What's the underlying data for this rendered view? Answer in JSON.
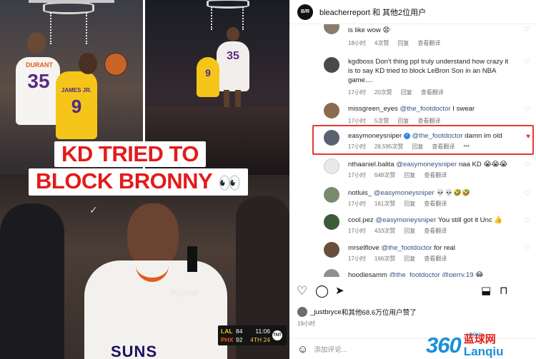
{
  "media": {
    "headline_line1": "KD TRIED TO",
    "headline_line2": "BLOCK BRONNY",
    "eyes_emoji": "👀",
    "jersey_left_name": "DURANT",
    "jersey_left_num": "35",
    "jersey_right_name": "JAMES JR.",
    "jersey_right_num": "9",
    "jersey_frame2_num": "35",
    "jersey_frame2_num2": "9",
    "sponsor": "PayPal",
    "bottom_team": "SUNS",
    "scorebug": {
      "team1": "LAL",
      "score1": "84",
      "team2": "PHX",
      "score2": "92",
      "clock": "11:06",
      "quarter": "4TH",
      "shot": "24",
      "network": "TNT"
    }
  },
  "header": {
    "account": "bleacherreport",
    "with_others": "和 其他2位用户"
  },
  "comments": [
    {
      "user": "",
      "text": "is like wow 😧",
      "time": "18小时",
      "likes": "4次赞",
      "reply": "回复",
      "translate": "查看翻译"
    },
    {
      "user": "kgdboss",
      "text": "Don't thing ppl truly understand how crazy it is to say KD tried to block LeBron Son in an NBA game....",
      "time": "17小时",
      "likes": "20次赞",
      "reply": "回复",
      "translate": "查看翻译"
    },
    {
      "user": "missgreen_eyes",
      "mention": "@the_footdoctor",
      "text": "I swear",
      "time": "17小时",
      "likes": "5次赞",
      "reply": "回复",
      "translate": "查看翻译"
    },
    {
      "user": "easymoneysniper",
      "mention": "@the_footdoctor",
      "text": "damn im old",
      "time": "17小时",
      "likes": "28,595次赞",
      "reply": "回复",
      "translate": "查看翻译",
      "more": "•••"
    },
    {
      "user": "nthaaniel.balita",
      "mention": "@easymoneysniper",
      "text": "naa KD 😭😭😭",
      "time": "17小时",
      "likes": "648次赞",
      "reply": "回复",
      "translate": "查看翻译"
    },
    {
      "user": "notluis_",
      "mention": "@easymoneysniper",
      "text": "💀💀🤣🤣",
      "time": "17小时",
      "likes": "161次赞",
      "reply": "回复",
      "translate": "查看翻译"
    },
    {
      "user": "cool.pez",
      "mention": "@easymoneysniper",
      "text": "You still got it Unc 👍",
      "time": "17小时",
      "likes": "433次赞",
      "reply": "回复",
      "translate": "查看翻译"
    },
    {
      "user": "mrselflove",
      "mention": "@the_footdoctor",
      "text": "for real",
      "time": "17小时",
      "likes": "166次赞",
      "reply": "回复",
      "translate": "查看翻译"
    },
    {
      "user": "hoodiesamm",
      "mention": "@the_footdoctor @perry.19",
      "text": "😂",
      "time": "",
      "likes": "",
      "reply": "",
      "translate": ""
    }
  ],
  "actions": {
    "like_icon": "heart-outline-icon",
    "comment_icon": "comment-icon",
    "share_icon": "send-icon",
    "repost_icon": "repost-icon",
    "save_icon": "bookmark-icon"
  },
  "liked_by": {
    "user": "_justbryce",
    "rest": "和其他68.6万位用户赞了"
  },
  "post_time": "19小时",
  "add_comment": {
    "placeholder": "添加评论..."
  },
  "watermark": {
    "num": "360",
    "com": ".COM",
    "cn": "蓝球网",
    "en": "Lanqiu"
  },
  "colors": {
    "highlight_red": "#e53935",
    "headline_red": "#e21b1b",
    "mention_blue": "#385185",
    "verified_blue": "#2f80ed"
  }
}
